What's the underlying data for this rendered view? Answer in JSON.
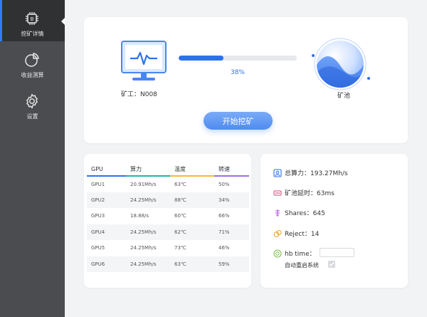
{
  "sidebar": {
    "items": [
      {
        "label": "挖矿详情",
        "icon": "cpu-chip-icon",
        "active": true
      },
      {
        "label": "收益测算",
        "icon": "pie-chart-icon",
        "active": false
      },
      {
        "label": "设置",
        "icon": "gear-icon",
        "active": false
      }
    ]
  },
  "mining": {
    "miner_label": "矿工：N008",
    "progress": 0.38,
    "progress_text": "38%",
    "pool_label": "矿池",
    "start_button": "开始挖矿"
  },
  "gpu_table": {
    "headers": [
      "GPU",
      "算力",
      "温度",
      "转速"
    ],
    "rows": [
      [
        "GPU1",
        "20.91Mh/s",
        "63℃",
        "50%"
      ],
      [
        "GPU2",
        "24.25Mh/s",
        "88℃",
        "34%"
      ],
      [
        "GPU3",
        "18.88/s",
        "60℃",
        "66%"
      ],
      [
        "GPU4",
        "24.25Mh/s",
        "62℃",
        "71%"
      ],
      [
        "GPU5",
        "24.25Mh/s",
        "73℃",
        "46%"
      ],
      [
        "GPU6",
        "24.25Mh/s",
        "63℃",
        "59%"
      ]
    ]
  },
  "stats": {
    "total_hashrate": "总算力：193.27Mh/s",
    "pool_latency": "矿池延时：63ms",
    "shares": "Shares：645",
    "reject": "Reject：14",
    "hb_time": "hb time：",
    "hb_time_value": "",
    "auto_restart": "自动重启系统",
    "auto_restart_checked": true
  },
  "colors": {
    "accent": "#2e72ea",
    "sidebar_bg": "#4b4c4f",
    "sidebar_active_bg": "#303133",
    "header_temp": "#f6b93b",
    "header_speed": "#9b6ee8",
    "header_hash": "#23b5a5"
  }
}
